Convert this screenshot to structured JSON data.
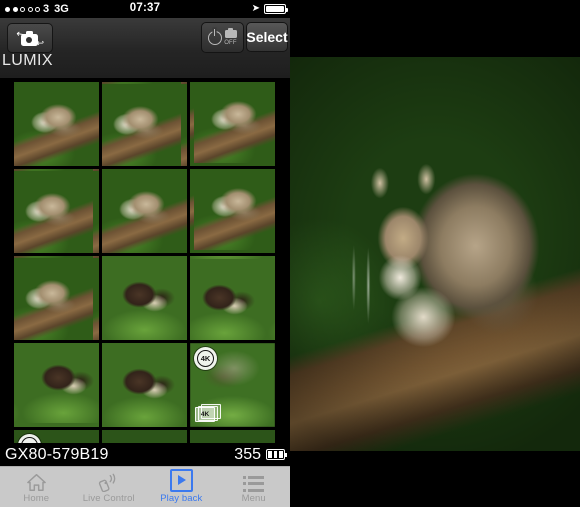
{
  "status_bar": {
    "signal_filled": 2,
    "signal_hollow": 3,
    "carrier": "3",
    "network": "3G",
    "time": "07:37",
    "location_icon": "location-arrow-icon",
    "battery_icon": "battery-icon",
    "battery_level": 92
  },
  "nav": {
    "camera_button_icon": "camera-connect-icon",
    "app_title": "LUMIX",
    "power_icon": "power-icon",
    "power_camera_icon": "camera-off-icon",
    "power_label": "OFF",
    "select_label": "Select"
  },
  "grid": {
    "items": [
      {
        "id": "thumb-1",
        "subject": "cat",
        "variant": "v1",
        "badge_4k": false,
        "badge_stack": false
      },
      {
        "id": "thumb-2",
        "subject": "cat",
        "variant": "v2",
        "badge_4k": false,
        "badge_stack": false
      },
      {
        "id": "thumb-3",
        "subject": "cat",
        "variant": "v3",
        "badge_4k": false,
        "badge_stack": false
      },
      {
        "id": "thumb-4",
        "subject": "cat",
        "variant": "v2",
        "badge_4k": false,
        "badge_stack": false
      },
      {
        "id": "thumb-5",
        "subject": "cat",
        "variant": "v1",
        "badge_4k": false,
        "badge_stack": false
      },
      {
        "id": "thumb-6",
        "subject": "cat",
        "variant": "v3",
        "badge_4k": false,
        "badge_stack": false
      },
      {
        "id": "thumb-7",
        "subject": "cat",
        "variant": "v2",
        "badge_4k": false,
        "badge_stack": false
      },
      {
        "id": "thumb-8",
        "subject": "otter",
        "variant": "v1",
        "badge_4k": false,
        "badge_stack": false
      },
      {
        "id": "thumb-9",
        "subject": "otter",
        "variant": "v2",
        "badge_4k": false,
        "badge_stack": false
      },
      {
        "id": "thumb-10",
        "subject": "otter",
        "variant": "v3",
        "badge_4k": false,
        "badge_stack": false
      },
      {
        "id": "thumb-11",
        "subject": "otter",
        "variant": "v1",
        "badge_4k": false,
        "badge_stack": false
      },
      {
        "id": "thumb-12",
        "subject": "blur",
        "variant": "v1",
        "badge_4k": true,
        "badge_stack": true
      },
      {
        "id": "thumb-13",
        "subject": "dark",
        "variant": "v1",
        "badge_4k": true,
        "badge_stack": false
      },
      {
        "id": "thumb-14",
        "subject": "dark",
        "variant": "v2",
        "badge_4k": false,
        "badge_stack": false
      },
      {
        "id": "thumb-15",
        "subject": "dark",
        "variant": "v3",
        "badge_4k": false,
        "badge_stack": false
      }
    ],
    "badge_4k_label": "4K",
    "badge_stack_label": "4K"
  },
  "info_strip": {
    "camera_name": "GX80-579B19",
    "remaining_count": "355",
    "battery_icon": "camera-battery-icon",
    "battery_bars": 3
  },
  "tabs": [
    {
      "id": "tab-home",
      "label": "Home",
      "icon": "home-icon",
      "active": false
    },
    {
      "id": "tab-live-control",
      "label": "Live Control",
      "icon": "remote-live-icon",
      "active": false
    },
    {
      "id": "tab-playback",
      "label": "Play back",
      "icon": "play-square-icon",
      "active": true
    },
    {
      "id": "tab-menu",
      "label": "Menu",
      "icon": "list-menu-icon",
      "active": false
    }
  ],
  "viewer": {
    "subject": "wildcat-on-log",
    "letterbox": true
  },
  "colors": {
    "accent": "#3b79ef",
    "tab_bar_bg": "#c9c9c9",
    "tab_inactive": "#9a9a9a",
    "nav_bg": "#2b2b2b",
    "panel_bg": "#000000"
  }
}
